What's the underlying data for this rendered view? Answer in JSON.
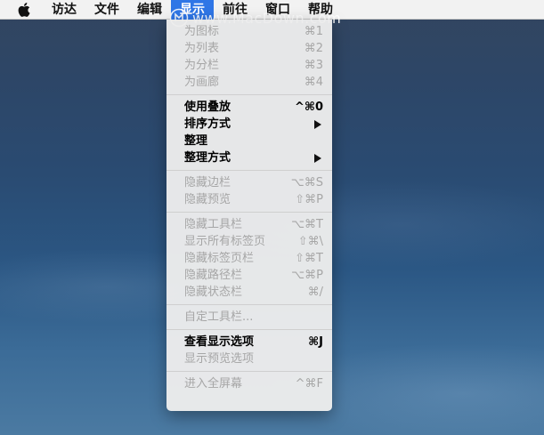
{
  "menubar": {
    "items": [
      {
        "label": "访达"
      },
      {
        "label": "文件"
      },
      {
        "label": "编辑"
      },
      {
        "label": "显示"
      },
      {
        "label": "前往"
      },
      {
        "label": "窗口"
      },
      {
        "label": "帮助"
      }
    ],
    "active_index": 3,
    "watermark": "www.MacDown.com"
  },
  "view_menu": {
    "groups": [
      [
        {
          "label": "为图标",
          "shortcut": "⌘1",
          "enabled": false
        },
        {
          "label": "为列表",
          "shortcut": "⌘2",
          "enabled": false
        },
        {
          "label": "为分栏",
          "shortcut": "⌘3",
          "enabled": false
        },
        {
          "label": "为画廊",
          "shortcut": "⌘4",
          "enabled": false
        }
      ],
      [
        {
          "label": "使用叠放",
          "shortcut": "^⌘0",
          "enabled": true
        },
        {
          "label": "排序方式",
          "submenu": true,
          "enabled": true
        },
        {
          "label": "整理",
          "enabled": true
        },
        {
          "label": "整理方式",
          "submenu": true,
          "enabled": true
        }
      ],
      [
        {
          "label": "隐藏边栏",
          "shortcut": "⌥⌘S",
          "enabled": false
        },
        {
          "label": "隐藏预览",
          "shortcut": "⇧⌘P",
          "enabled": false
        }
      ],
      [
        {
          "label": "隐藏工具栏",
          "shortcut": "⌥⌘T",
          "enabled": false
        },
        {
          "label": "显示所有标签页",
          "shortcut": "⇧⌘\\",
          "enabled": false
        },
        {
          "label": "隐藏标签页栏",
          "shortcut": "⇧⌘T",
          "enabled": false
        },
        {
          "label": "隐藏路径栏",
          "shortcut": "⌥⌘P",
          "enabled": false
        },
        {
          "label": "隐藏状态栏",
          "shortcut": "⌘/",
          "enabled": false
        }
      ],
      [
        {
          "label": "自定工具栏...",
          "enabled": false
        }
      ],
      [
        {
          "label": "查看显示选项",
          "shortcut": "⌘J",
          "enabled": true
        },
        {
          "label": "显示预览选项",
          "enabled": false
        }
      ],
      [
        {
          "label": "进入全屏幕",
          "shortcut": "^⌘F",
          "enabled": false
        }
      ]
    ]
  },
  "colors": {
    "menubar_bg": "#f2f2f2",
    "active_menu_bg": "#2f76e6",
    "disabled_text": "#a6a6a6",
    "enabled_text": "#000000"
  },
  "icons": {
    "apple": "apple-icon",
    "submenu_arrow": "chevron-right-icon",
    "watermark_logo": "macdown-logo-icon"
  }
}
